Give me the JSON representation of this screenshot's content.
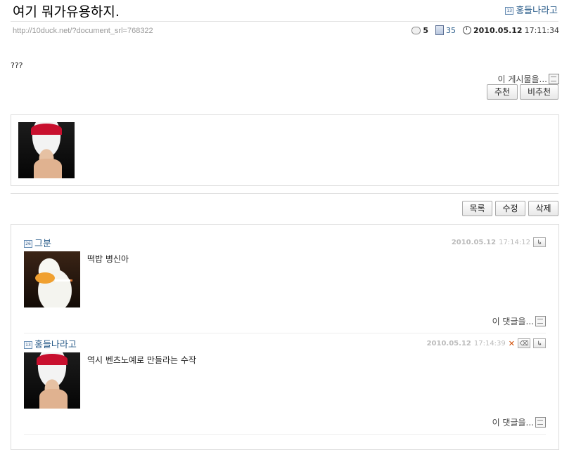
{
  "post": {
    "title": "여기 뭐가유용하지.",
    "author_level": "13",
    "author": "홍들나라고",
    "url": "http://10duck.net/?document_srl=768322",
    "comment_count": "5",
    "view_count": "35",
    "date": "2010.05.12",
    "time": "17:11:34",
    "body": "???",
    "vote_label": "이 게시물을...",
    "recommend_label": "추천",
    "unrecommend_label": "비추천"
  },
  "actions": {
    "list_label": "목록",
    "edit_label": "수정",
    "delete_label": "삭제"
  },
  "comments": [
    {
      "author_level": "26",
      "author": "그분",
      "date": "2010.05.12",
      "time": "17:14:12",
      "text": "떡밥 병신아",
      "more_label": "이 댓글을..."
    },
    {
      "author_level": "13",
      "author": "홍들나라고",
      "date": "2010.05.12",
      "time": "17:14:39",
      "text": "역시 벤츠노예로 만들라는 수작",
      "more_label": "이 댓글을..."
    }
  ],
  "icons": {
    "comment": "comment-bubble-icon",
    "views": "document-icon",
    "clock": "clock-icon",
    "reply": "reply-arrow-icon",
    "modify": "eraser-icon",
    "delete": "delete-x-icon",
    "menu": "popup-menu-icon"
  }
}
